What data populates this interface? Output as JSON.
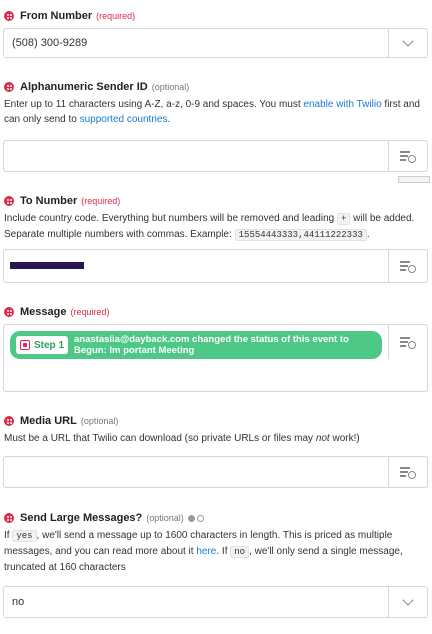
{
  "from_number": {
    "label": "From Number",
    "required": "(required)",
    "value": "(508) 300-9289"
  },
  "alpha_sender": {
    "label": "Alphanumeric Sender ID",
    "optional": "(optional)",
    "help_pre": "Enter up to 11 characters using A-Z, a-z, 0-9 and spaces. You must ",
    "link1": "enable with Twilio",
    "help_mid": " first and can only send to ",
    "link2": "supported countries",
    "help_post": ".",
    "value": ""
  },
  "to_number": {
    "label": "To Number",
    "required": "(required)",
    "help_pre": "Include country code. Everything but numbers will be removed and leading ",
    "code1": "+",
    "help_mid": " will be added. Separate multiple numbers with commas. Example: ",
    "code2": "15554443333,44111222333",
    "help_post": "."
  },
  "message": {
    "label": "Message",
    "required": "(required)",
    "step_label": "Step 1",
    "pill_text": "anastasiia@dayback.com changed the status of this event to Begun: Im portant Meeting"
  },
  "media_url": {
    "label": "Media URL",
    "optional": "(optional)",
    "help_pre": "Must be a URL that Twilio can download (so private URLs or files may ",
    "help_em": "not",
    "help_post": " work!)",
    "value": ""
  },
  "large_messages": {
    "label": "Send Large Messages?",
    "optional": "(optional)",
    "help_a": "If ",
    "code_yes": "yes",
    "help_b": ", we'll send a message up to 1600 characters in length. This is priced as multiple messages, and you can read more about it ",
    "link": "here",
    "help_c": ". If ",
    "code_no": "no",
    "help_d": ", we'll only send a single message, truncated at 160 characters",
    "value": "no"
  },
  "icons": {
    "field": "twilio-icon",
    "dropdown": "chevron-down-icon",
    "insert": "insert-field-icon",
    "step": "step-app-icon"
  },
  "colors": {
    "required": "#e0294a",
    "link": "#1a7bd4",
    "pill": "#4dc886"
  }
}
